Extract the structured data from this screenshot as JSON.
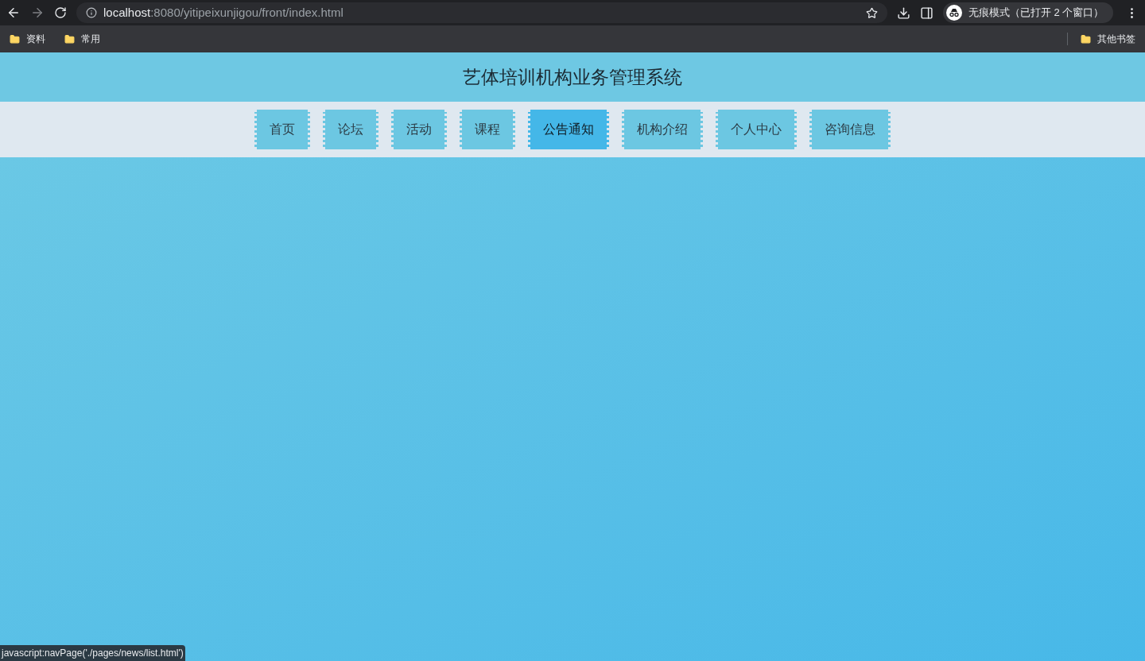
{
  "browser": {
    "url_host": "localhost",
    "url_path": ":8080/yitipeixunjigou/front/index.html",
    "profile": "无痕模式（已打开 2 个窗口）",
    "bookmarks": [
      "资料",
      "常用"
    ],
    "other_bookmarks": "其他书签"
  },
  "site": {
    "title": "艺体培训机构业务管理系统"
  },
  "nav": [
    {
      "label": "首页",
      "selected": false
    },
    {
      "label": "论坛",
      "selected": false
    },
    {
      "label": "活动",
      "selected": false
    },
    {
      "label": "课程",
      "selected": false
    },
    {
      "label": "公告通知",
      "selected": true
    },
    {
      "label": "机构介绍",
      "selected": false
    },
    {
      "label": "个人中心",
      "selected": false
    },
    {
      "label": "咨询信息",
      "selected": false
    }
  ],
  "status_bar": "javascript:navPage('./pages/news/list.html')"
}
